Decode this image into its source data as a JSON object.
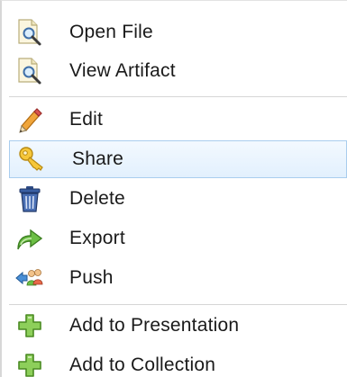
{
  "menu": {
    "items": [
      {
        "label": "Open File",
        "icon": "magnifier-document-icon"
      },
      {
        "label": "View Artifact",
        "icon": "magnifier-document-icon"
      },
      {
        "label": "Edit",
        "icon": "pencil-icon"
      },
      {
        "label": "Share",
        "icon": "key-icon",
        "selected": true
      },
      {
        "label": "Delete",
        "icon": "trash-icon"
      },
      {
        "label": "Export",
        "icon": "export-arrow-icon"
      },
      {
        "label": "Push",
        "icon": "users-arrow-icon"
      },
      {
        "label": "Add to Presentation",
        "icon": "green-plus-icon"
      },
      {
        "label": "Add to Collection",
        "icon": "green-plus-icon"
      }
    ]
  },
  "colors": {
    "selected_background": "#e2f0fd",
    "selected_border": "#a9cdee",
    "separator": "#d6d6d6",
    "text": "#1a1a1a"
  }
}
